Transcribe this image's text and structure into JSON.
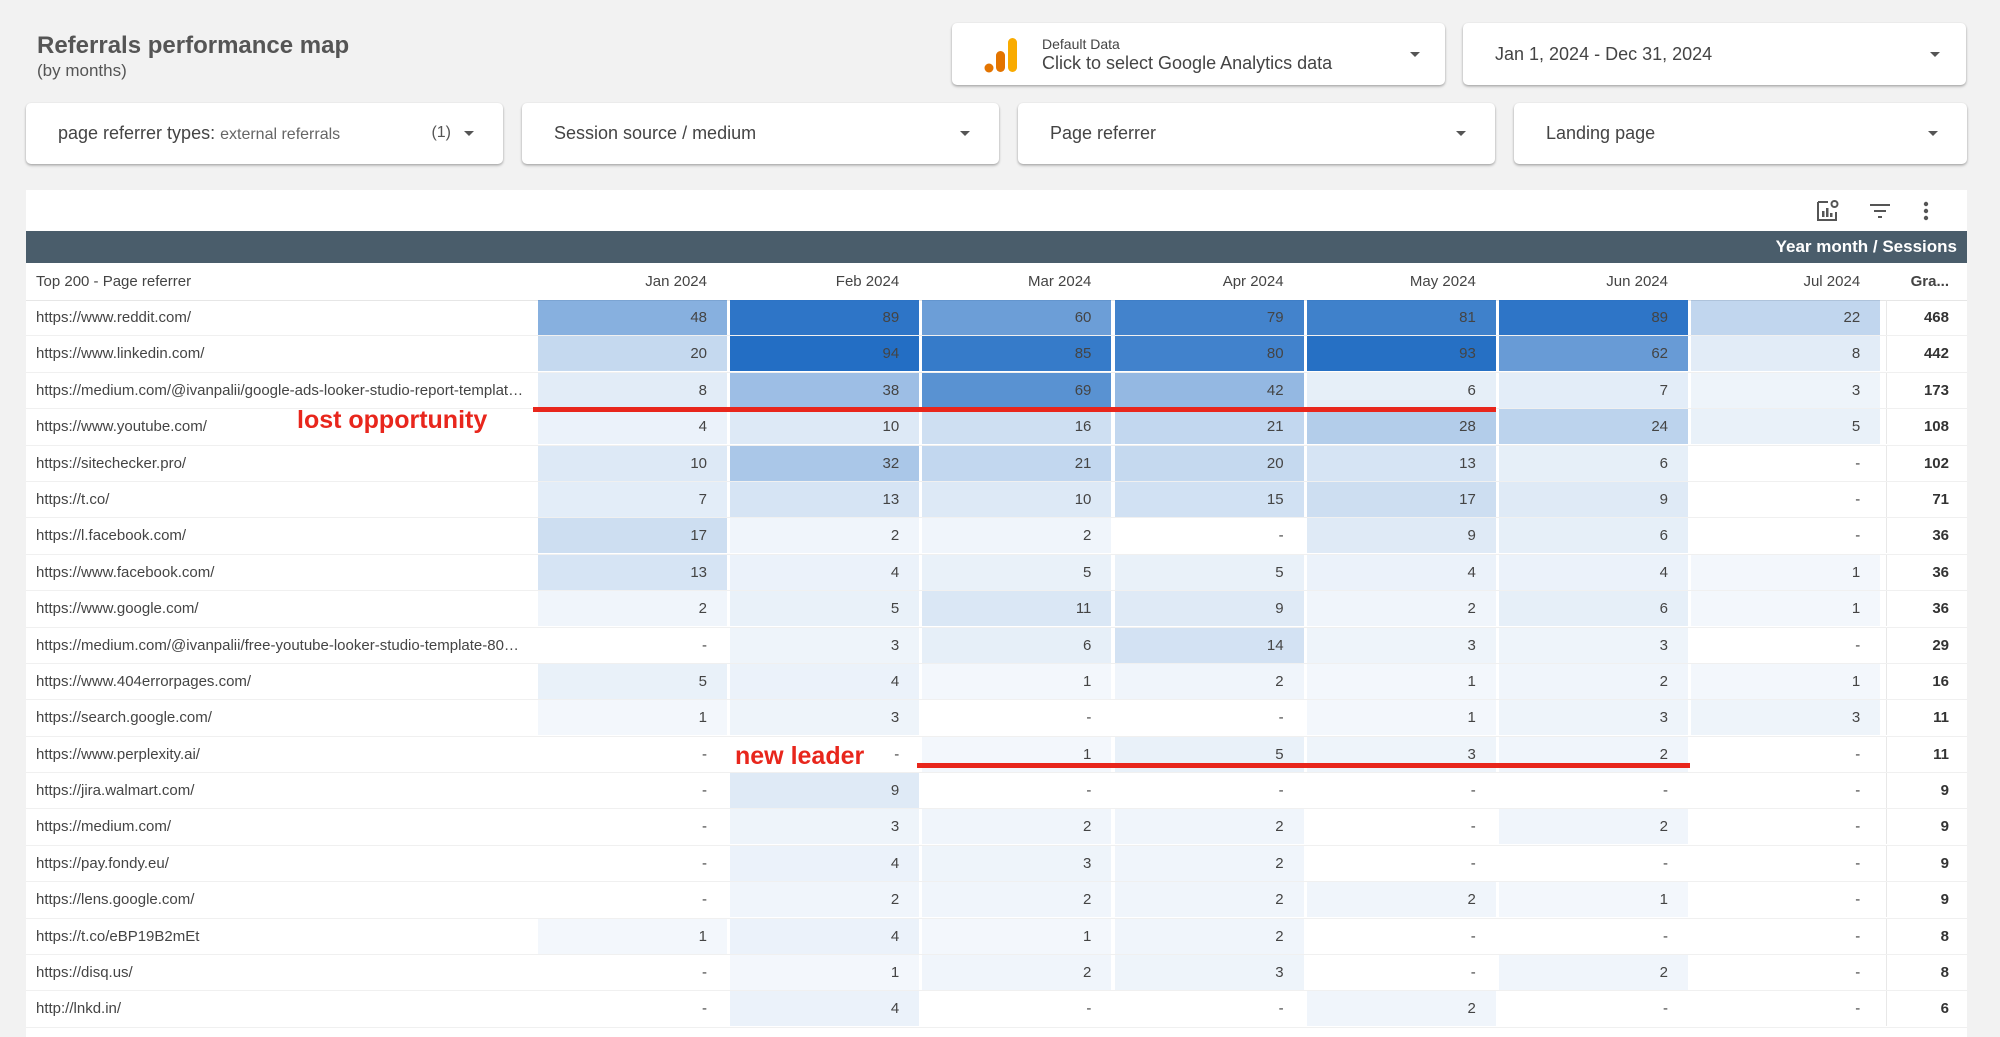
{
  "header": {
    "title": "Referrals performance map",
    "subtitle": "(by months)"
  },
  "data_source": {
    "label": "Default Data",
    "action": "Click to select Google Analytics data"
  },
  "date_range": "Jan 1, 2024 - Dec 31, 2024",
  "filters": [
    {
      "label": "page referrer types",
      "value": "external referrals",
      "count": "(1)"
    },
    {
      "label": "Session source / medium"
    },
    {
      "label": "Page referrer"
    },
    {
      "label": "Landing page"
    }
  ],
  "table": {
    "toolbar_icons": [
      "chart-settings-icon",
      "filter-icon",
      "more-vert-icon"
    ],
    "column_group_header": "Year month / Sessions",
    "row_dimension_header": "Top 200 - Page referrer",
    "columns": [
      "Jan 2024",
      "Feb 2024",
      "Mar 2024",
      "Apr 2024",
      "May 2024",
      "Jun 2024",
      "Jul 2024"
    ],
    "grand_total_header": "Gra...",
    "max_value": 94,
    "heat_color": "#1565c0",
    "rows": [
      {
        "referrer": "https://www.reddit.com/",
        "values": [
          "48",
          "89",
          "60",
          "79",
          "81",
          "89",
          "22"
        ],
        "total": "468"
      },
      {
        "referrer": "https://www.linkedin.com/",
        "values": [
          "20",
          "94",
          "85",
          "80",
          "93",
          "62",
          "8"
        ],
        "total": "442"
      },
      {
        "referrer": "https://medium.com/@ivanpalii/google-ads-looker-studio-report-templat…",
        "values": [
          "8",
          "38",
          "69",
          "42",
          "6",
          "7",
          "3"
        ],
        "total": "173"
      },
      {
        "referrer": "https://www.youtube.com/",
        "values": [
          "4",
          "10",
          "16",
          "21",
          "28",
          "24",
          "5"
        ],
        "total": "108"
      },
      {
        "referrer": "https://sitechecker.pro/",
        "values": [
          "10",
          "32",
          "21",
          "20",
          "13",
          "6",
          "-"
        ],
        "total": "102"
      },
      {
        "referrer": "https://t.co/",
        "values": [
          "7",
          "13",
          "10",
          "15",
          "17",
          "9",
          "-"
        ],
        "total": "71"
      },
      {
        "referrer": "https://l.facebook.com/",
        "values": [
          "17",
          "2",
          "2",
          "-",
          "9",
          "6",
          "-"
        ],
        "total": "36"
      },
      {
        "referrer": "https://www.facebook.com/",
        "values": [
          "13",
          "4",
          "5",
          "5",
          "4",
          "4",
          "1"
        ],
        "total": "36"
      },
      {
        "referrer": "https://www.google.com/",
        "values": [
          "2",
          "5",
          "11",
          "9",
          "2",
          "6",
          "1"
        ],
        "total": "36"
      },
      {
        "referrer": "https://medium.com/@ivanpalii/free-youtube-looker-studio-template-80…",
        "values": [
          "-",
          "3",
          "6",
          "14",
          "3",
          "3",
          "-"
        ],
        "total": "29"
      },
      {
        "referrer": "https://www.404errorpages.com/",
        "values": [
          "5",
          "4",
          "1",
          "2",
          "1",
          "2",
          "1"
        ],
        "total": "16"
      },
      {
        "referrer": "https://search.google.com/",
        "values": [
          "1",
          "3",
          "-",
          "-",
          "1",
          "3",
          "3"
        ],
        "total": "11"
      },
      {
        "referrer": "https://www.perplexity.ai/",
        "values": [
          "-",
          "-",
          "1",
          "5",
          "3",
          "2",
          "-"
        ],
        "total": "11"
      },
      {
        "referrer": "https://jira.walmart.com/",
        "values": [
          "-",
          "9",
          "-",
          "-",
          "-",
          "-",
          "-"
        ],
        "total": "9"
      },
      {
        "referrer": "https://medium.com/",
        "values": [
          "-",
          "3",
          "2",
          "2",
          "-",
          "2",
          "-"
        ],
        "total": "9"
      },
      {
        "referrer": "https://pay.fondy.eu/",
        "values": [
          "-",
          "4",
          "3",
          "2",
          "-",
          "-",
          "-"
        ],
        "total": "9"
      },
      {
        "referrer": "https://lens.google.com/",
        "values": [
          "-",
          "2",
          "2",
          "2",
          "2",
          "1",
          "-"
        ],
        "total": "9"
      },
      {
        "referrer": "https://t.co/eBP19B2mEt",
        "values": [
          "1",
          "4",
          "1",
          "2",
          "-",
          "-",
          "-"
        ],
        "total": "8"
      },
      {
        "referrer": "https://disq.us/",
        "values": [
          "-",
          "1",
          "2",
          "3",
          "-",
          "2",
          "-"
        ],
        "total": "8"
      },
      {
        "referrer": "http://lnkd.in/",
        "values": [
          "-",
          "4",
          "-",
          "-",
          "2",
          "-",
          "-"
        ],
        "total": "6"
      }
    ]
  },
  "annotations": [
    {
      "text": "lost opportunity",
      "color": "#e8261c"
    },
    {
      "text": "new leader",
      "color": "#e8261c"
    }
  ]
}
